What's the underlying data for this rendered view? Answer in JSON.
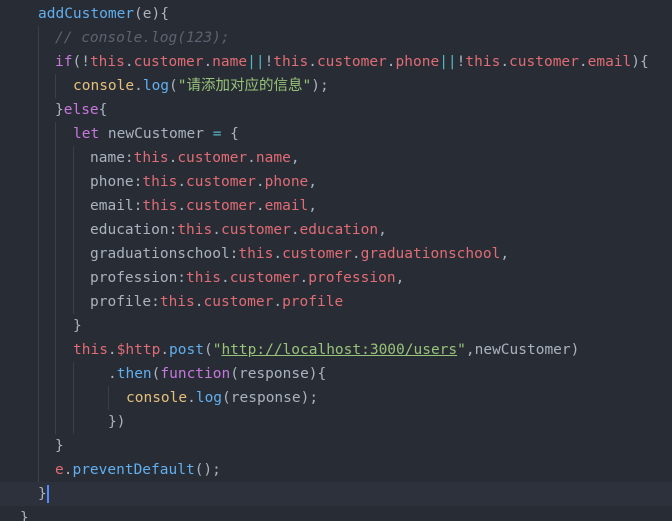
{
  "editor": {
    "language": "javascript",
    "theme_colors": {
      "background": "#282c34",
      "active_line": "#2c313c",
      "function": "#61afef",
      "keyword": "#c678dd",
      "property": "#e06c75",
      "string": "#98c379",
      "comment": "#5c6370",
      "text": "#abb2bf",
      "cursor": "#528bff"
    },
    "lines": [
      "addCustomer(e){",
      "// console.log(123);",
      "if(!this.customer.name||!this.customer.phone||!this.customer.email){",
      "console.log(\"请添加对应的信息\");",
      "}else{",
      "let newCustomer = {",
      "name:this.customer.name,",
      "phone:this.customer.phone,",
      "email:this.customer.email,",
      "education:this.customer.education,",
      "graduationschool:this.customer.graduationschool,",
      "profession:this.customer.profession,",
      "profile:this.customer.profile",
      "}",
      "this.$http.post(\"http://localhost:3000/users\",newCustomer)",
      ".then(function(response){",
      "console.log(response);",
      "})",
      "}",
      "e.preventDefault();",
      "}",
      "}"
    ]
  }
}
